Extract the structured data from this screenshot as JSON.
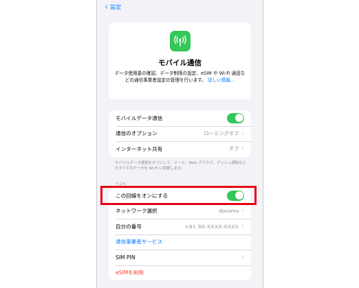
{
  "nav": {
    "back_label": "設定"
  },
  "intro": {
    "icon": "antenna-icon",
    "title": "モバイル通信",
    "description": "データ使用量の確認、データ制限の設定、eSIM や Wi-Fi 通話などの通信事業者設定の管理を行います。",
    "link": "詳しい情報..."
  },
  "cellular": {
    "rows": [
      {
        "label": "モバイルデータ通信",
        "toggle": "on"
      },
      {
        "label": "通信のオプション",
        "value": "ローミングオフ"
      },
      {
        "label": "インターネット共有",
        "value": "オフ"
      }
    ],
    "footnote": "モバイルデータ通信をオフにして、メール、Web ブラウズ、プッシュ通知などのすべてのデータを Wi-Fi に制限します。"
  },
  "line": {
    "header": "ドコモ",
    "rows": [
      {
        "label": "この回線をオンにする",
        "toggle": "on"
      },
      {
        "label": "ネットワーク選択",
        "value": "docomo"
      },
      {
        "label": "自分の番号",
        "value": "+81 90-XXXX-XXXX"
      },
      {
        "label": "通信事業者サービス"
      },
      {
        "label": "SIM PIN"
      },
      {
        "label": "eSIMを削除"
      }
    ]
  },
  "colors": {
    "accent": "#0a7aff",
    "toggle_on": "#34c759",
    "danger": "#ff3b30",
    "highlight": "#e60012"
  }
}
